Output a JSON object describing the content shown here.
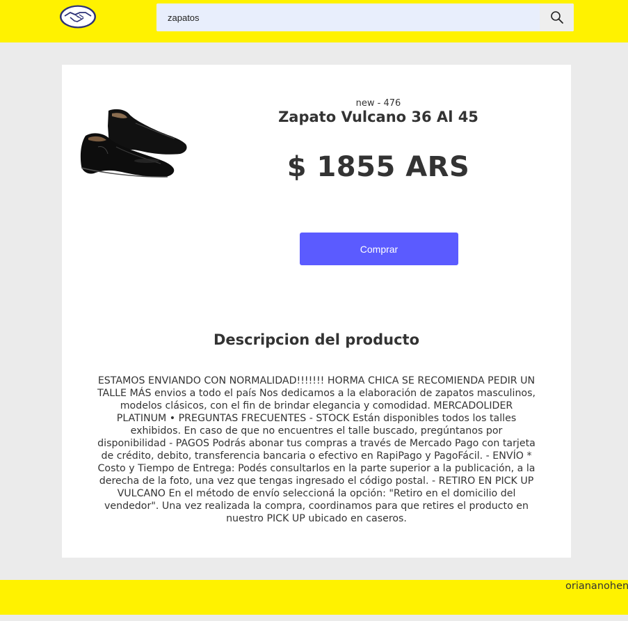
{
  "header": {
    "logo_icon": "handshake-logo-icon",
    "search": {
      "value": "zapatos",
      "placeholder": "",
      "button_icon": "search-icon"
    }
  },
  "product": {
    "condition_sold": "new - 476",
    "title": "Zapato Vulcano 36 Al 45",
    "price": "$ 1855 ARS",
    "buy_label": "Comprar",
    "image_icon": "black-shoe-image"
  },
  "description": {
    "heading": "Descripcion del producto",
    "text": "ESTAMOS ENVIANDO CON NORMALIDAD!!!!!!! HORMA CHICA SE RECOMIENDA PEDIR UN TALLE MÁS envios a todo el país Nos dedicamos a la elaboración de zapatos masculinos, modelos clásicos, con el fin de brindar elegancia y comodidad. MERCADOLIDER PLATINUM • PREGUNTAS FRECUENTES - STOCK Están disponibles todos los talles exhibidos. En caso de que no encuentres el talle buscado, pregúntanos por disponibilidad - PAGOS Podrás abonar tus compras a través de Mercado Pago con tarjeta de crédito, debito, transferencia bancaria o efectivo en RapiPago y PagoFácil. - ENVÍO * Costo y Tiempo de Entrega: Podés consultarlos en la parte superior a la publicación, a la derecha de la foto, una vez que tengas ingresado el código postal. - RETIRO EN PICK UP VULCANO En el método de envío seleccioná la opción: \"Retiro en el domicilio del vendedor\". Una vez realizada la compra, coordinamos para que retires el producto en nuestro PICK UP ubicado en caseros."
  },
  "footer": {
    "user": "oriananohen"
  },
  "colors": {
    "brand_yellow": "#fff200",
    "button_blue": "#5b5bff",
    "page_bg": "#ebebeb"
  }
}
